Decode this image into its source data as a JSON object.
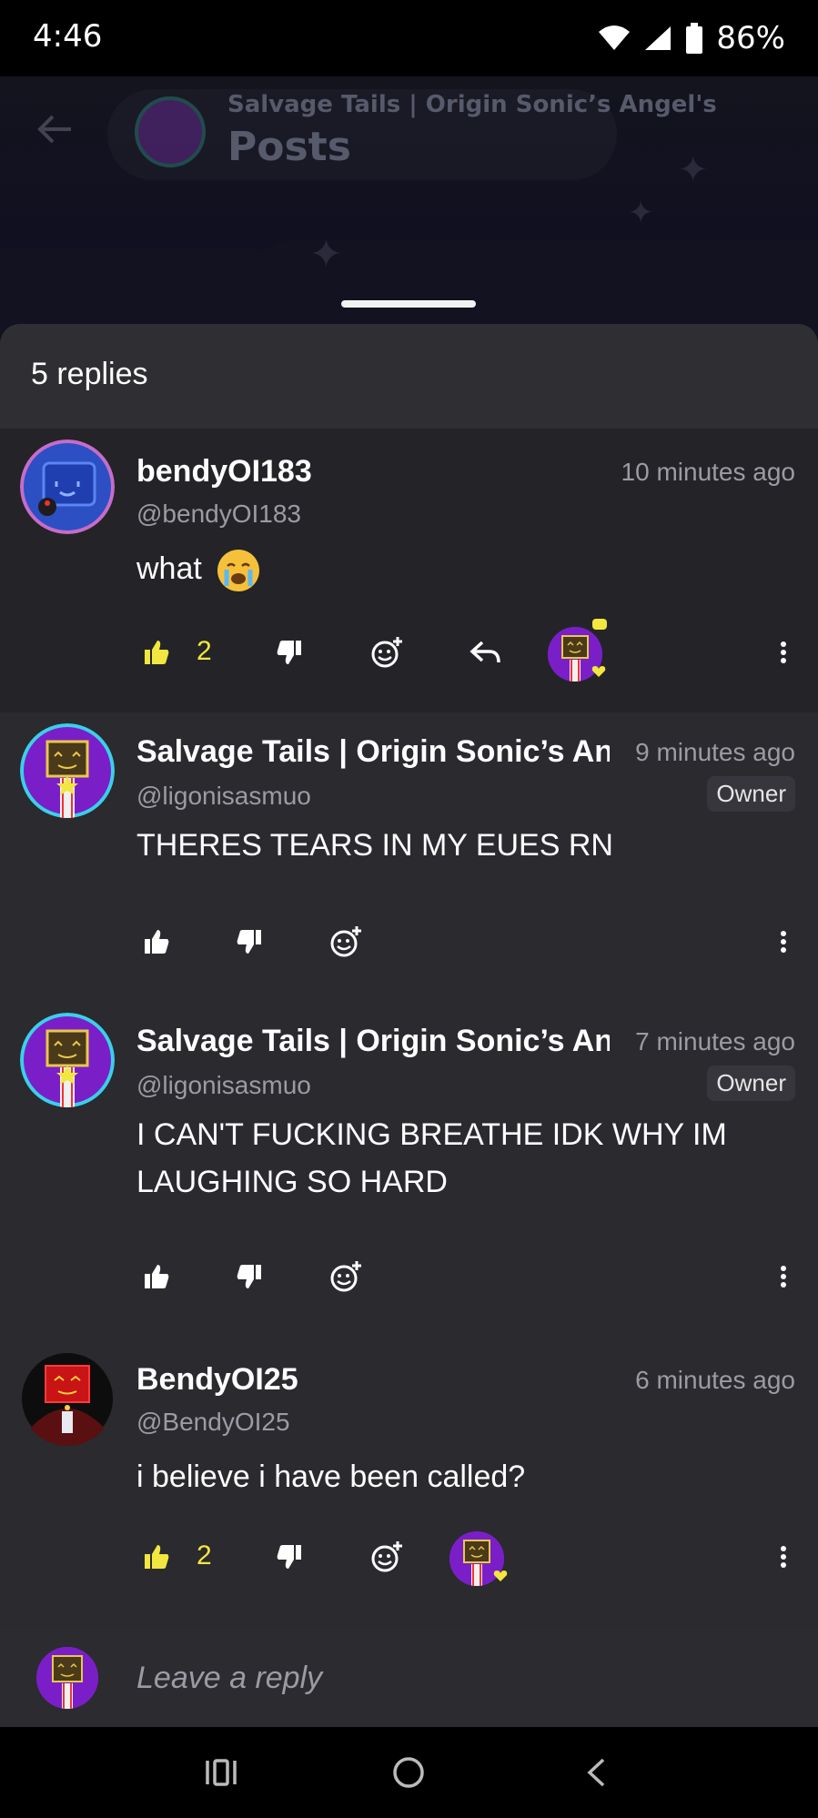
{
  "status_bar": {
    "time": "4:46",
    "battery": "86%"
  },
  "background": {
    "community_name": "Salvage Tails | Origin Sonic’s Angel's",
    "page_title": "Posts"
  },
  "sheet": {
    "replies_count": "5 replies"
  },
  "replies": [
    {
      "username": "bendyOI183",
      "handle": "@bendyOI183",
      "time": "10 minutes ago",
      "text": "what",
      "emoji": "crying-face",
      "likes": "2",
      "liked": true
    },
    {
      "username": "Salvage Tails | Origin Sonic’s Angel's",
      "handle": "@ligonisasmuo",
      "time": "9 minutes ago",
      "badge": "Owner",
      "text": "THERES TEARS IN MY EUES RN"
    },
    {
      "username": "Salvage Tails | Origin Sonic’s Angel's",
      "handle": "@ligonisasmuo",
      "time": "7 minutes ago",
      "badge": "Owner",
      "text": "I CAN'T FUCKING BREATHE IDK WHY IM LAUGHING SO HARD"
    },
    {
      "username": "BendyOI25",
      "handle": "@BendyOI25",
      "time": "6 minutes ago",
      "text": "i believe i have been called?",
      "likes": "2",
      "liked": true
    }
  ],
  "reply_bar": {
    "placeholder": "Leave a reply"
  },
  "colors": {
    "like_active": "#f2e640",
    "sheet_bg": "#242428",
    "text_secondary": "#9b9ba3"
  }
}
